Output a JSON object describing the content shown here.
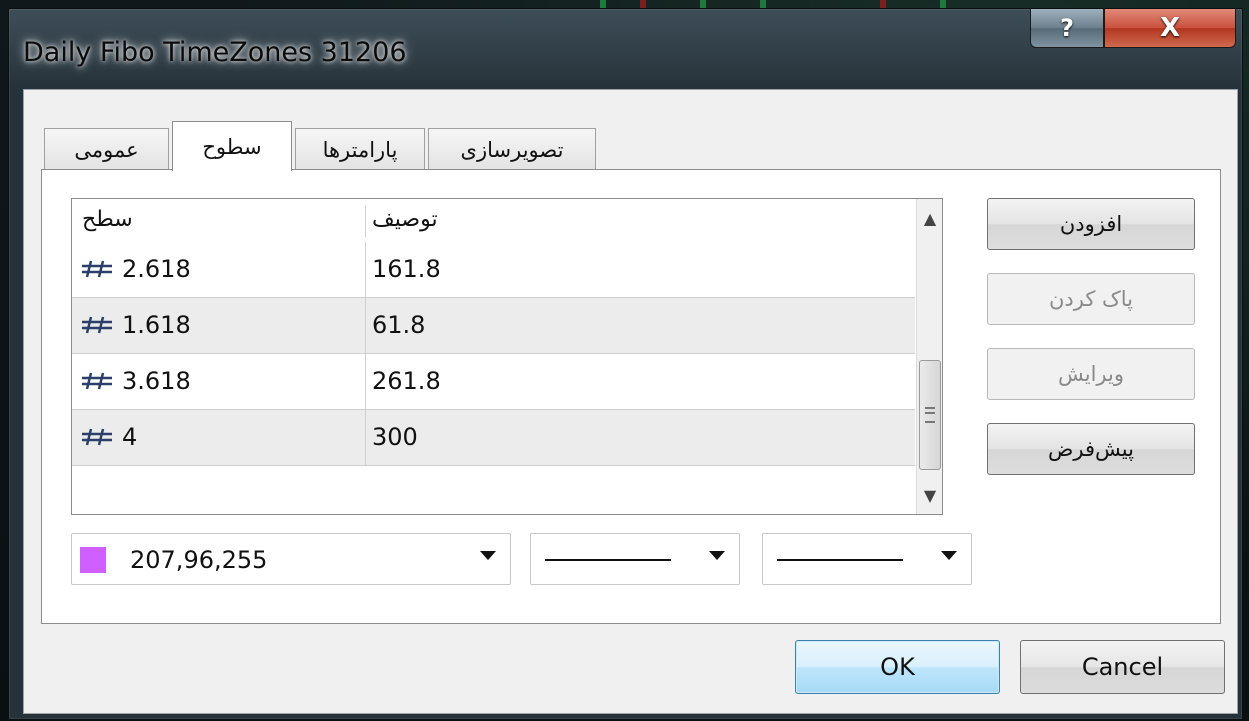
{
  "window": {
    "title": "Daily Fibo TimeZones 31206",
    "help_label": "?",
    "close_label": "X"
  },
  "tabs": [
    {
      "label": "عمومی",
      "active": false
    },
    {
      "label": "سطوح",
      "active": true
    },
    {
      "label": "پارامترها",
      "active": false
    },
    {
      "label": "تصویرسازی",
      "active": false
    }
  ],
  "levels_table": {
    "columns": [
      "سطح",
      "توصیف"
    ],
    "rows": [
      {
        "level": "2.618",
        "description": "161.8"
      },
      {
        "level": "1.618",
        "description": "61.8"
      },
      {
        "level": "3.618",
        "description": "261.8"
      },
      {
        "level": "4",
        "description": "300"
      }
    ],
    "level_icon": "fibo-level-icon"
  },
  "side_buttons": {
    "add": "افزودن",
    "delete": "پاک کردن",
    "edit": "ویرایش",
    "default": "پیش‌فرض"
  },
  "style_controls": {
    "color_value": "207,96,255",
    "color_hex": "#cf60ff"
  },
  "dialog_buttons": {
    "ok": "OK",
    "cancel": "Cancel"
  }
}
